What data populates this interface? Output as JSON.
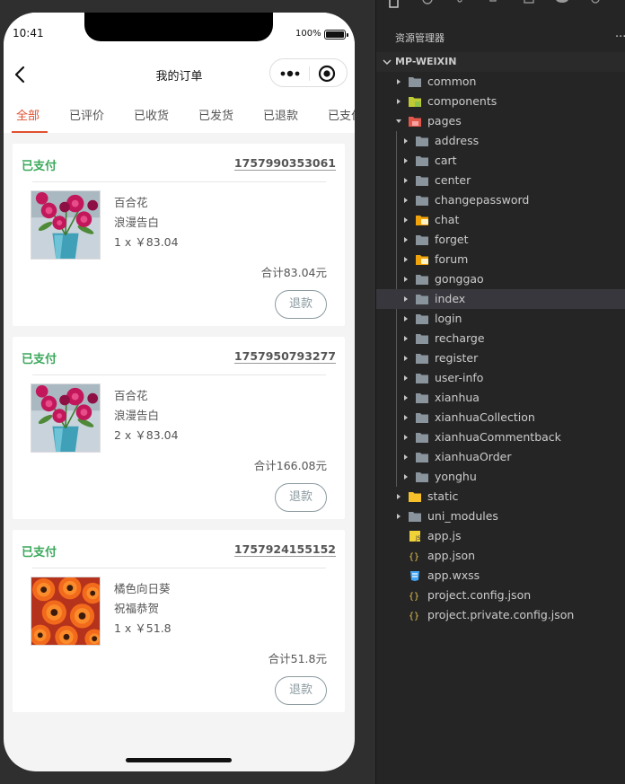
{
  "status_bar": {
    "time": "10:41",
    "battery": "100%"
  },
  "navbar": {
    "title": "我的订单"
  },
  "tabs": [
    "全部",
    "已评价",
    "已收货",
    "已发货",
    "已退款",
    "已支付"
  ],
  "orders": [
    {
      "status": "已支付",
      "id": "1757990353061",
      "name": "百合花",
      "desc": "浪漫告白",
      "qty": "1 x ￥83.04",
      "total": "合计83.04元",
      "refund": "退款",
      "image": "lily"
    },
    {
      "status": "已支付",
      "id": "1757950793277",
      "name": "百合花",
      "desc": "浪漫告白",
      "qty": "2 x ￥83.04",
      "total": "合计166.08元",
      "refund": "退款",
      "image": "lily"
    },
    {
      "status": "已支付",
      "id": "1757924155152",
      "name": "橘色向日葵",
      "desc": "祝福恭贺",
      "qty": "1 x ￥51.8",
      "total": "合计51.8元",
      "refund": "退款",
      "image": "sunflower"
    }
  ],
  "explorer": {
    "title": "资源管理器",
    "more": "···",
    "root": "MP-WEIXIN",
    "items": [
      {
        "label": "common",
        "type": "folder",
        "depth": 1
      },
      {
        "label": "components",
        "type": "folder-special",
        "depth": 1
      },
      {
        "label": "pages",
        "type": "folder-open",
        "depth": 1
      },
      {
        "label": "address",
        "type": "folder",
        "depth": 2
      },
      {
        "label": "cart",
        "type": "folder",
        "depth": 2
      },
      {
        "label": "center",
        "type": "folder",
        "depth": 2
      },
      {
        "label": "changepassword",
        "type": "folder",
        "depth": 2
      },
      {
        "label": "chat",
        "type": "folder-chat",
        "depth": 2
      },
      {
        "label": "forget",
        "type": "folder",
        "depth": 2
      },
      {
        "label": "forum",
        "type": "folder-chat",
        "depth": 2
      },
      {
        "label": "gonggao",
        "type": "folder",
        "depth": 2
      },
      {
        "label": "index",
        "type": "folder",
        "depth": 2,
        "selected": true
      },
      {
        "label": "login",
        "type": "folder",
        "depth": 2
      },
      {
        "label": "recharge",
        "type": "folder",
        "depth": 2
      },
      {
        "label": "register",
        "type": "folder",
        "depth": 2
      },
      {
        "label": "user-info",
        "type": "folder",
        "depth": 2
      },
      {
        "label": "xianhua",
        "type": "folder",
        "depth": 2
      },
      {
        "label": "xianhuaCollection",
        "type": "folder",
        "depth": 2
      },
      {
        "label": "xianhuaCommentback",
        "type": "folder",
        "depth": 2
      },
      {
        "label": "xianhuaOrder",
        "type": "folder",
        "depth": 2
      },
      {
        "label": "yonghu",
        "type": "folder",
        "depth": 2
      },
      {
        "label": "static",
        "type": "folder-yellow",
        "depth": 1
      },
      {
        "label": "uni_modules",
        "type": "folder",
        "depth": 1
      },
      {
        "label": "app.js",
        "type": "file-js",
        "depth": 1
      },
      {
        "label": "app.json",
        "type": "file-json",
        "depth": 1
      },
      {
        "label": "app.wxss",
        "type": "file-css",
        "depth": 1
      },
      {
        "label": "project.config.json",
        "type": "file-json",
        "depth": 1
      },
      {
        "label": "project.private.config.json",
        "type": "file-json",
        "depth": 1
      }
    ]
  },
  "colors": {
    "accent": "#e0502f",
    "paid": "#3aa85a",
    "selected_row": "#37373d"
  }
}
